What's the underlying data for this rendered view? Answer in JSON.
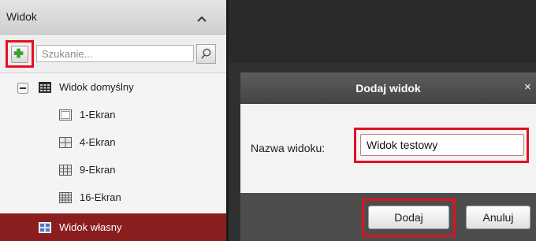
{
  "panel": {
    "title": "Widok",
    "search_placeholder": "Szukanie...",
    "tree": [
      {
        "label": "Widok domyślny",
        "icon": "grid-view-icon",
        "expander": "minus"
      },
      {
        "label": "1-Ekran",
        "icon": "layout-1-icon"
      },
      {
        "label": "4-Ekran",
        "icon": "layout-4-icon"
      },
      {
        "label": "9-Ekran",
        "icon": "layout-9-icon"
      },
      {
        "label": "16-Ekran",
        "icon": "layout-16-icon"
      },
      {
        "label": "Widok własny",
        "icon": "custom-view-icon",
        "selected": true
      }
    ]
  },
  "dialog": {
    "title": "Dodaj widok",
    "close_glyph": "×",
    "field_label": "Nazwa widoku:",
    "field_value": "Widok testowy",
    "add_label": "Dodaj",
    "cancel_label": "Anuluj"
  },
  "colors": {
    "highlight": "#e3101f",
    "selected_row": "#8a1e1e",
    "add_icon": "#35a02a",
    "dialog_header": "#505050"
  }
}
